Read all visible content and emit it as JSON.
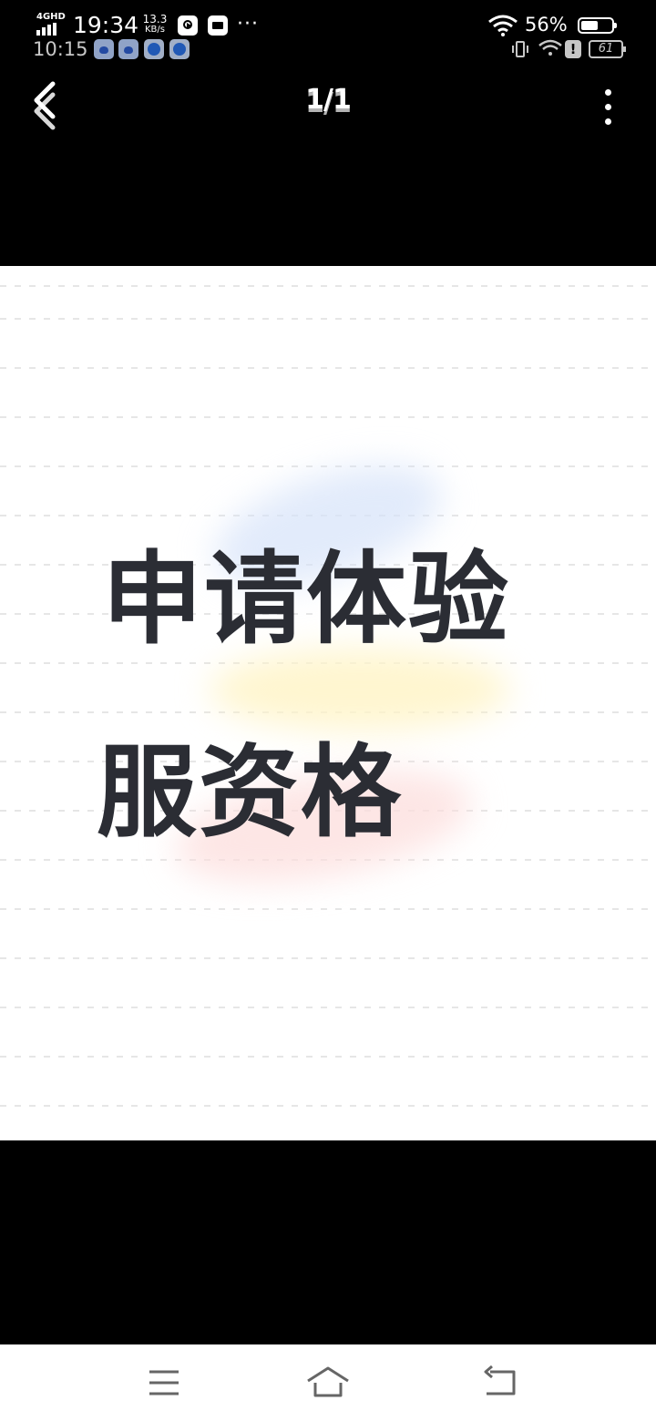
{
  "status_bar": {
    "network_type": "4GHD",
    "time_primary": "19:34",
    "net_speed_value": "13.3",
    "net_speed_unit": "KB/s",
    "time_secondary": "10:15",
    "overflow": "···",
    "battery_percent_label": "56%",
    "battery_level": 0.56,
    "battery_secondary": "61"
  },
  "viewer": {
    "page_counter": "1/1"
  },
  "image": {
    "line1": "申请体验",
    "line2": "服资格",
    "text_color": "#2b2d34"
  },
  "icons": {
    "back": "chevron-left-icon",
    "more": "more-vertical-icon",
    "menu": "menu-icon",
    "home": "home-icon",
    "return": "return-icon"
  }
}
